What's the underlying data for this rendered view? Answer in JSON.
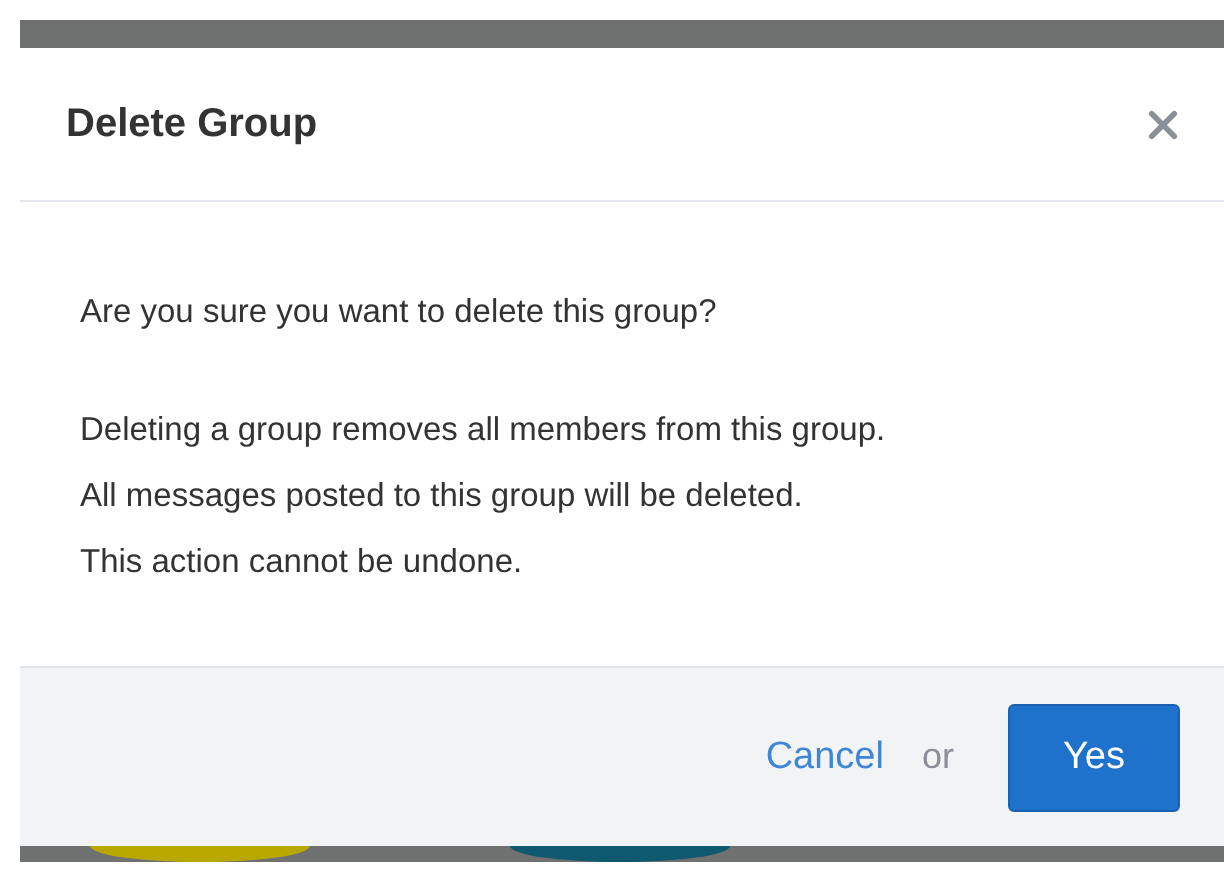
{
  "dialog": {
    "title": "Delete Group",
    "question": "Are you sure you want to delete this group?",
    "details": [
      "Deleting a group removes all members from this group.",
      "All messages posted to this group will be deleted.",
      "This action cannot be undone."
    ],
    "footer": {
      "cancel": "Cancel",
      "separator": "or",
      "confirm": "Yes"
    }
  }
}
